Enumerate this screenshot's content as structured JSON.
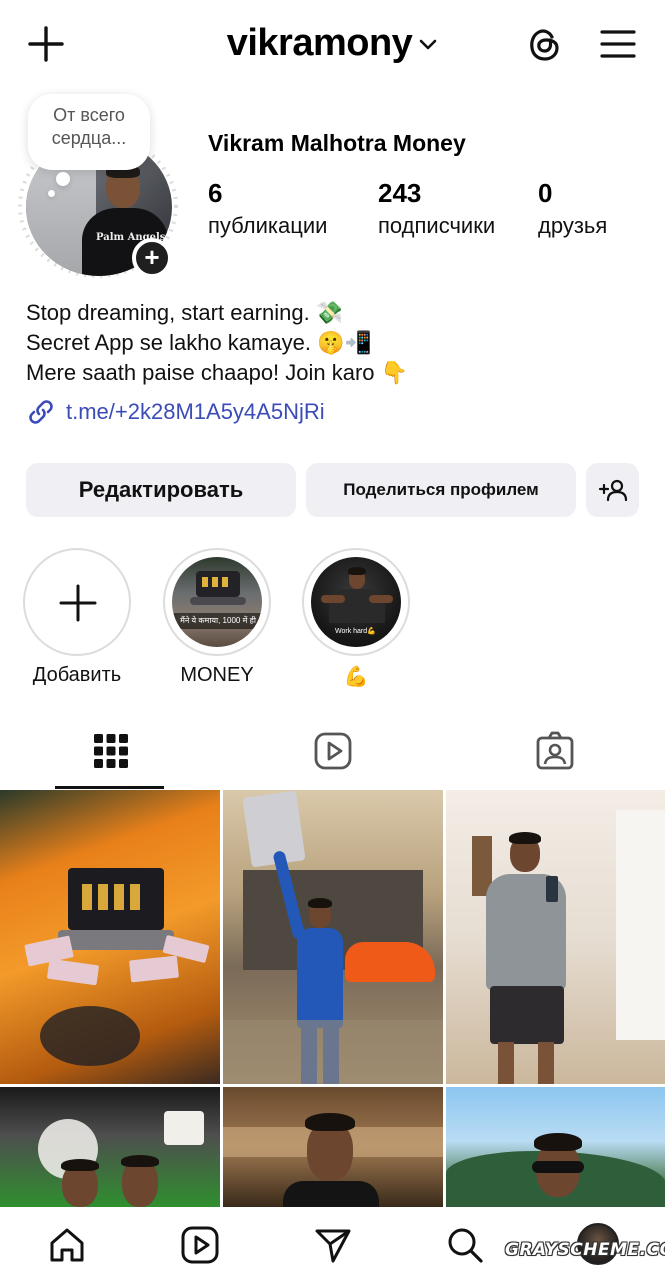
{
  "header": {
    "username": "vikramony"
  },
  "profile": {
    "note": "От всего сердца...",
    "full_name": "Vikram Malhotra Money",
    "avatar_shirt_text": "Palm Angels",
    "stats": {
      "posts": {
        "value": "6",
        "label": "публикации"
      },
      "followers": {
        "value": "243",
        "label": "подписчики"
      },
      "friends": {
        "value": "0",
        "label": "друзья"
      }
    },
    "bio": [
      "Stop dreaming, start earning. 💸",
      "Secret App se lakho kamaye. 🤫📲",
      "Mere saath paise chaapo! Join karo 👇"
    ],
    "link": "t.me/+2k28M1A5y4A5NjRi"
  },
  "actions": {
    "edit_label": "Редактировать",
    "share_label": "Поделиться профилем"
  },
  "highlights": [
    {
      "label": "Добавить",
      "icon": "plus-icon"
    },
    {
      "label": "MONEY",
      "cover_caption": "मैंने ये कमाया, 1000 में ही"
    },
    {
      "label": "💪",
      "cover_caption": "Work hard💪"
    }
  ],
  "tabs": [
    "grid-icon",
    "reels-icon",
    "tagged-icon"
  ],
  "bottom_nav": [
    "home-icon",
    "reels-icon",
    "direct-icon",
    "search-icon",
    "profile-avatar"
  ],
  "watermark": "GRAYSCHEME.COM",
  "colors": {
    "link": "#3b4bb8",
    "button_bg": "#efeff4"
  }
}
